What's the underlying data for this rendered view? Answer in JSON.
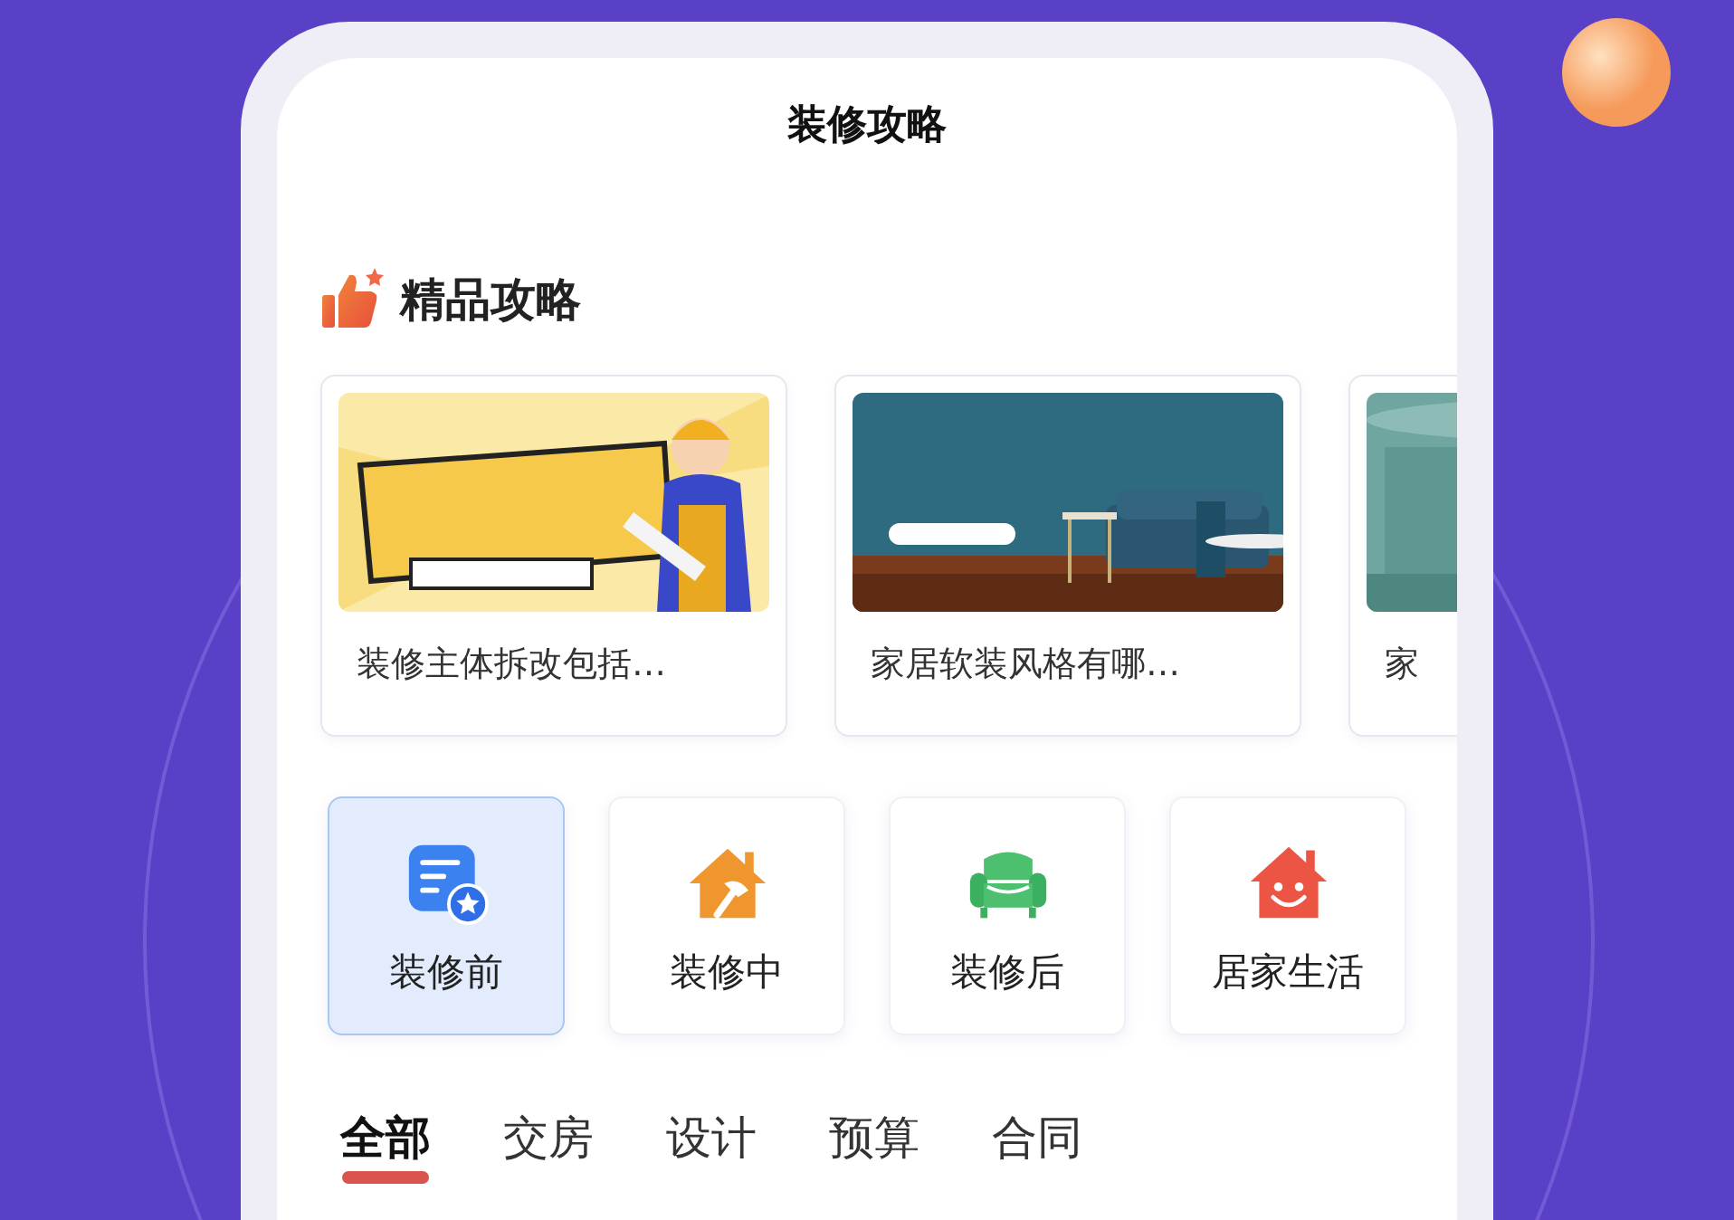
{
  "screen": {
    "title": "装修攻略"
  },
  "featured": {
    "title": "精品攻略",
    "articles": [
      {
        "kind": "picture",
        "caption": "装修主体拆改包括…"
      },
      {
        "kind": "picture",
        "caption": "家居软装风格有哪…"
      },
      {
        "kind": "picture",
        "caption": "家"
      }
    ]
  },
  "categories": [
    {
      "label": "装修前",
      "kind": "document",
      "selected": true
    },
    {
      "label": "装修中",
      "kind": "hammer-house",
      "selected": false
    },
    {
      "label": "装修后",
      "kind": "sofa",
      "selected": false
    },
    {
      "label": "居家生活",
      "kind": "smile-house",
      "selected": false
    }
  ],
  "tabs": [
    {
      "label": "全部",
      "selected": true
    },
    {
      "label": "交房",
      "selected": false
    },
    {
      "label": "设计",
      "selected": false
    },
    {
      "label": "预算",
      "selected": false
    },
    {
      "label": "合同",
      "selected": false
    }
  ]
}
